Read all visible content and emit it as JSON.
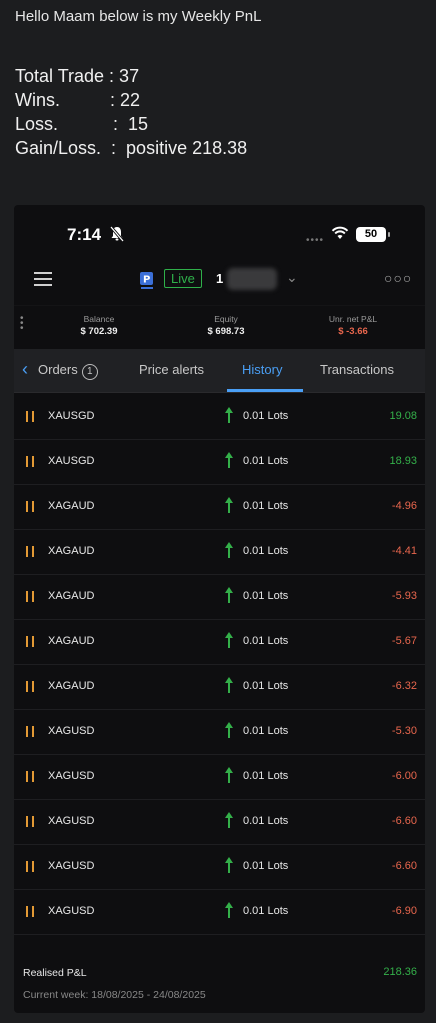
{
  "message": {
    "greeting": "Hello Maam below is my Weekly PnL",
    "total_trade": "Total Trade : 37",
    "wins": "Wins.          : 22",
    "loss": "Loss.           :  15",
    "gain_loss": "Gain/Loss.  :  positive 218.38"
  },
  "status_bar": {
    "time": "7:14",
    "battery": "50",
    "icons": [
      "bell-off-icon",
      "signal-icon",
      "wifi-icon",
      "battery-icon"
    ]
  },
  "app_bar": {
    "live_label": "Live",
    "account_prefix": "1",
    "icons": [
      "menu-icon",
      "broker-logo-icon",
      "chevron-down-icon",
      "more-icon"
    ]
  },
  "metrics": {
    "balance_label": "Balance",
    "balance_value": "$ 702.39",
    "equity_label": "Equity",
    "equity_value": "$ 698.73",
    "unr_label": "Unr. net P&L",
    "unr_value": "$ -3.66"
  },
  "tabs": {
    "orders": "Orders",
    "orders_count": "1",
    "price_alerts": "Price alerts",
    "history": "History",
    "transactions": "Transactions",
    "active": "History"
  },
  "trades": [
    {
      "symbol": "XAUSGD",
      "lots": "0.01 Lots",
      "pnl": "19.08",
      "direction": "up"
    },
    {
      "symbol": "XAUSGD",
      "lots": "0.01 Lots",
      "pnl": "18.93",
      "direction": "up"
    },
    {
      "symbol": "XAGAUD",
      "lots": "0.01 Lots",
      "pnl": "-4.96",
      "direction": "up"
    },
    {
      "symbol": "XAGAUD",
      "lots": "0.01 Lots",
      "pnl": "-4.41",
      "direction": "up"
    },
    {
      "symbol": "XAGAUD",
      "lots": "0.01 Lots",
      "pnl": "-5.93",
      "direction": "up"
    },
    {
      "symbol": "XAGAUD",
      "lots": "0.01 Lots",
      "pnl": "-5.67",
      "direction": "up"
    },
    {
      "symbol": "XAGAUD",
      "lots": "0.01 Lots",
      "pnl": "-6.32",
      "direction": "up"
    },
    {
      "symbol": "XAGUSD",
      "lots": "0.01 Lots",
      "pnl": "-5.30",
      "direction": "up"
    },
    {
      "symbol": "XAGUSD",
      "lots": "0.01 Lots",
      "pnl": "-6.00",
      "direction": "up"
    },
    {
      "symbol": "XAGUSD",
      "lots": "0.01 Lots",
      "pnl": "-6.60",
      "direction": "up"
    },
    {
      "symbol": "XAGUSD",
      "lots": "0.01 Lots",
      "pnl": "-6.60",
      "direction": "up"
    },
    {
      "symbol": "XAGUSD",
      "lots": "0.01 Lots",
      "pnl": "-6.90",
      "direction": "up"
    }
  ],
  "footer": {
    "realised_label": "Realised P&L",
    "realised_value": "218.36",
    "current_week": "Current week: 18/08/2025 - 24/08/2025"
  },
  "colors": {
    "positive": "#34b04a",
    "negative": "#e8664d",
    "accent": "#4a9ff5",
    "live": "#2fb04a",
    "pause": "#e39a35"
  }
}
